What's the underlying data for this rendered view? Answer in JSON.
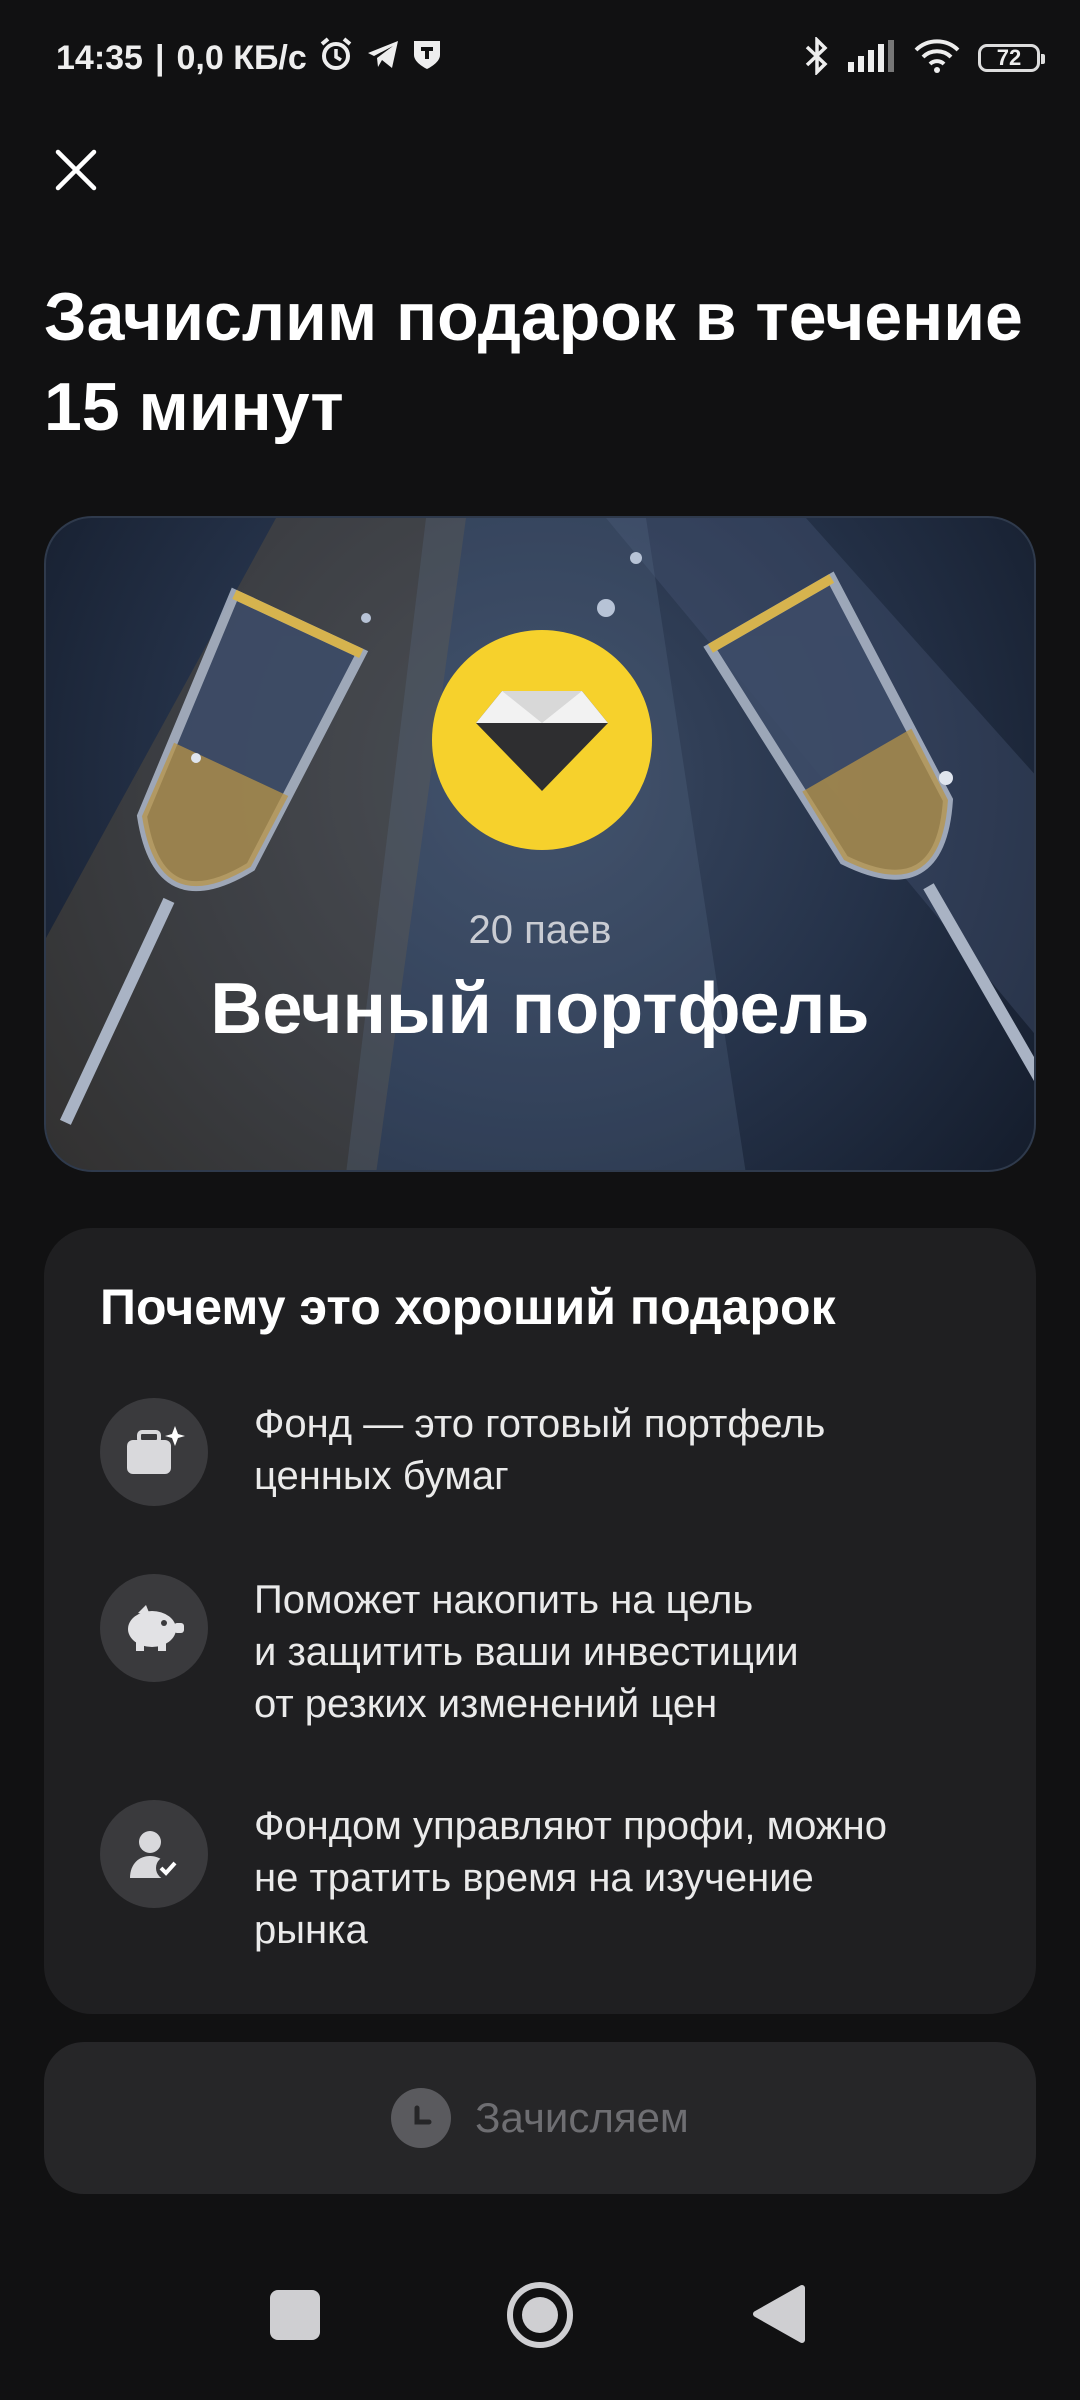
{
  "status_bar": {
    "time": "14:35",
    "separator": "|",
    "speed": "0,0 КБ/с",
    "battery": "72",
    "icons": [
      "alarm-icon",
      "telegram-icon",
      "vpn-shield-icon",
      "bluetooth-icon",
      "signal-icon",
      "wifi-icon",
      "battery-icon"
    ]
  },
  "header": {
    "title": "Зачислим подарок в течение 15 минут"
  },
  "banner": {
    "units": "20 паев",
    "fund_name": "Вечный портфель",
    "accent_color": "#f6d12c"
  },
  "reasons": {
    "title": "Почему это хороший подарок",
    "items": [
      {
        "icon": "briefcase-sparkle-icon",
        "text": "Фонд — это готовый портфель\nценных бумаг"
      },
      {
        "icon": "piggy-bank-icon",
        "text": "Поможет накопить на цель\nи защитить ваши инвестиции\nот резких изменений цен"
      },
      {
        "icon": "manager-check-icon",
        "text": "Фондом управляют профи, можно\nне тратить время на изучение\nрынка"
      }
    ]
  },
  "action": {
    "label": "Зачисляем",
    "icon": "clock-icon"
  },
  "nav": {
    "icons": [
      "recents-icon",
      "home-icon",
      "back-icon"
    ]
  }
}
